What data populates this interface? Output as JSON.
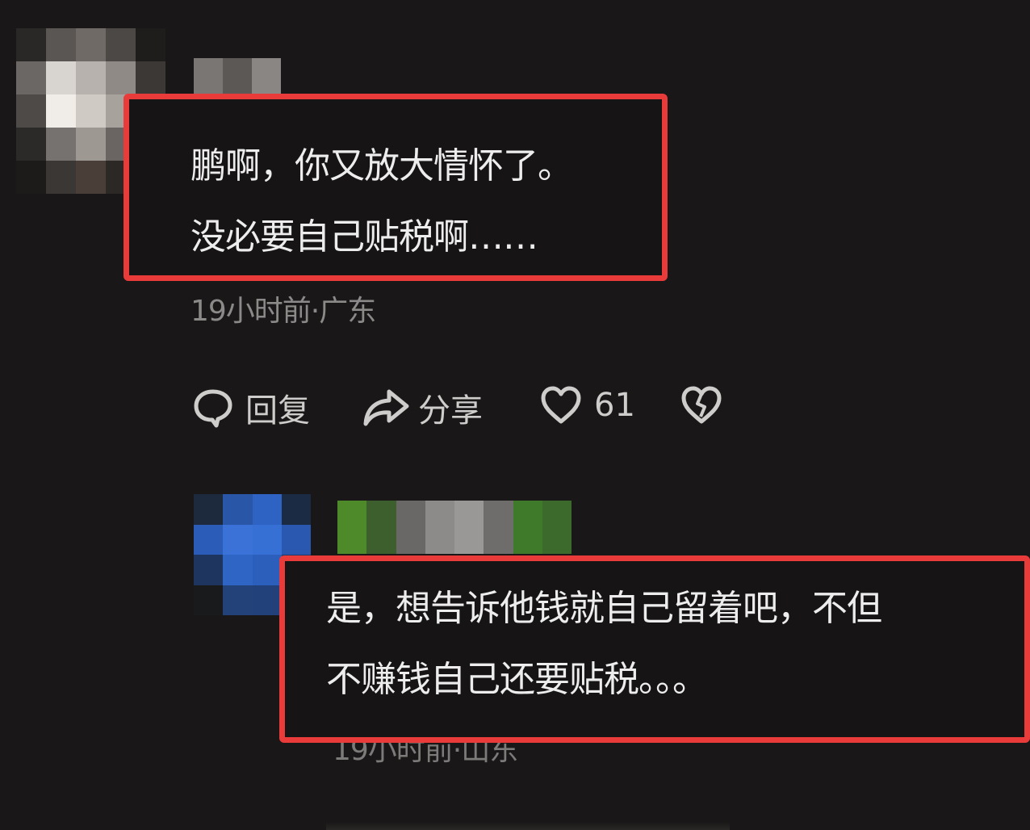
{
  "comments": [
    {
      "text_lines": [
        "鹏啊，你又放大情怀了。",
        "没必要自己贴税啊……"
      ],
      "meta": "19小时前·广东",
      "actions": {
        "reply_label": "回复",
        "share_label": "分享",
        "like_count": "61"
      }
    },
    {
      "text_lines": [
        "是，想告诉他钱就自己留着吧，不但",
        "不赚钱自己还要贴税。。。"
      ],
      "meta": "19小时前·山东"
    }
  ],
  "colors": {
    "background": "#191717",
    "highlight_border": "#ea3b3b",
    "text": "#ededed",
    "meta": "#8c8a88"
  },
  "icons": [
    "comment-bubble-icon",
    "share-arrow-icon",
    "heart-icon",
    "broken-heart-icon"
  ]
}
